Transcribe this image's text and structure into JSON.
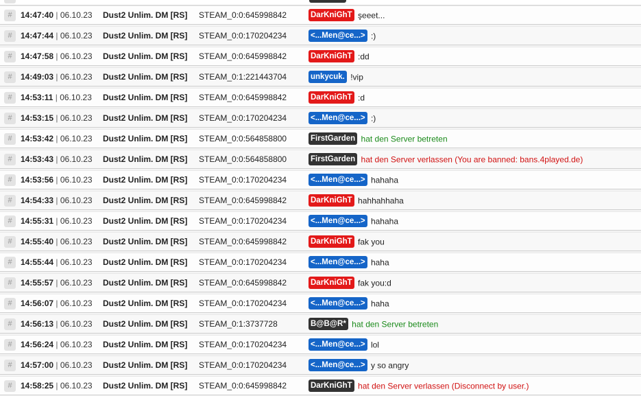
{
  "colors": {
    "red": "#e31919",
    "blue": "#1565c8",
    "dark": "#333333",
    "join": "#1a8a1a",
    "leave": "#d11111"
  },
  "icons": {
    "row_marker": "hash-icon"
  },
  "rows": [
    {
      "hash": "#",
      "time": "14:47:40",
      "sep": "|",
      "date": "06.10.23",
      "server": "Dust2 Unlim. DM [RS]",
      "steam": "STEAM_0:0:645998842",
      "player": "DarKniGhT",
      "color": "red",
      "msg": "şeeet...",
      "kind": "chat"
    },
    {
      "hash": "#",
      "time": "14:47:44",
      "sep": "|",
      "date": "06.10.23",
      "server": "Dust2 Unlim. DM [RS]",
      "steam": "STEAM_0:0:170204234",
      "player": "<...Men@ce...>",
      "color": "blue",
      "msg": ":)",
      "kind": "chat"
    },
    {
      "hash": "#",
      "time": "14:47:58",
      "sep": "|",
      "date": "06.10.23",
      "server": "Dust2 Unlim. DM [RS]",
      "steam": "STEAM_0:0:645998842",
      "player": "DarKniGhT",
      "color": "red",
      "msg": ":dd",
      "kind": "chat"
    },
    {
      "hash": "#",
      "time": "14:49:03",
      "sep": "|",
      "date": "06.10.23",
      "server": "Dust2 Unlim. DM [RS]",
      "steam": "STEAM_0:1:221443704",
      "player": "unkycuk.",
      "color": "blue",
      "msg": "!vip",
      "kind": "chat"
    },
    {
      "hash": "#",
      "time": "14:53:11",
      "sep": "|",
      "date": "06.10.23",
      "server": "Dust2 Unlim. DM [RS]",
      "steam": "STEAM_0:0:645998842",
      "player": "DarKniGhT",
      "color": "red",
      "msg": ":d",
      "kind": "chat"
    },
    {
      "hash": "#",
      "time": "14:53:15",
      "sep": "|",
      "date": "06.10.23",
      "server": "Dust2 Unlim. DM [RS]",
      "steam": "STEAM_0:0:170204234",
      "player": "<...Men@ce...>",
      "color": "blue",
      "msg": ":)",
      "kind": "chat"
    },
    {
      "hash": "#",
      "time": "14:53:42",
      "sep": "|",
      "date": "06.10.23",
      "server": "Dust2 Unlim. DM [RS]",
      "steam": "STEAM_0:0:564858800",
      "player": "FirstGarden",
      "color": "dark",
      "msg": "hat den Server betreten",
      "kind": "join"
    },
    {
      "hash": "#",
      "time": "14:53:43",
      "sep": "|",
      "date": "06.10.23",
      "server": "Dust2 Unlim. DM [RS]",
      "steam": "STEAM_0:0:564858800",
      "player": "FirstGarden",
      "color": "dark",
      "msg": "hat den Server verlassen (You are banned: bans.4played.de)",
      "kind": "leave"
    },
    {
      "hash": "#",
      "time": "14:53:56",
      "sep": "|",
      "date": "06.10.23",
      "server": "Dust2 Unlim. DM [RS]",
      "steam": "STEAM_0:0:170204234",
      "player": "<...Men@ce...>",
      "color": "blue",
      "msg": "hahaha",
      "kind": "chat"
    },
    {
      "hash": "#",
      "time": "14:54:33",
      "sep": "|",
      "date": "06.10.23",
      "server": "Dust2 Unlim. DM [RS]",
      "steam": "STEAM_0:0:645998842",
      "player": "DarKniGhT",
      "color": "red",
      "msg": "hahhahhaha",
      "kind": "chat"
    },
    {
      "hash": "#",
      "time": "14:55:31",
      "sep": "|",
      "date": "06.10.23",
      "server": "Dust2 Unlim. DM [RS]",
      "steam": "STEAM_0:0:170204234",
      "player": "<...Men@ce...>",
      "color": "blue",
      "msg": "hahaha",
      "kind": "chat"
    },
    {
      "hash": "#",
      "time": "14:55:40",
      "sep": "|",
      "date": "06.10.23",
      "server": "Dust2 Unlim. DM [RS]",
      "steam": "STEAM_0:0:645998842",
      "player": "DarKniGhT",
      "color": "red",
      "msg": "fak you",
      "kind": "chat"
    },
    {
      "hash": "#",
      "time": "14:55:44",
      "sep": "|",
      "date": "06.10.23",
      "server": "Dust2 Unlim. DM [RS]",
      "steam": "STEAM_0:0:170204234",
      "player": "<...Men@ce...>",
      "color": "blue",
      "msg": "haha",
      "kind": "chat"
    },
    {
      "hash": "#",
      "time": "14:55:57",
      "sep": "|",
      "date": "06.10.23",
      "server": "Dust2 Unlim. DM [RS]",
      "steam": "STEAM_0:0:645998842",
      "player": "DarKniGhT",
      "color": "red",
      "msg": "fak you:d",
      "kind": "chat"
    },
    {
      "hash": "#",
      "time": "14:56:07",
      "sep": "|",
      "date": "06.10.23",
      "server": "Dust2 Unlim. DM [RS]",
      "steam": "STEAM_0:0:170204234",
      "player": "<...Men@ce...>",
      "color": "blue",
      "msg": "haha",
      "kind": "chat"
    },
    {
      "hash": "#",
      "time": "14:56:13",
      "sep": "|",
      "date": "06.10.23",
      "server": "Dust2 Unlim. DM [RS]",
      "steam": "STEAM_0:1:3737728",
      "player": "B@B@R*",
      "color": "dark",
      "msg": "hat den Server betreten",
      "kind": "join"
    },
    {
      "hash": "#",
      "time": "14:56:24",
      "sep": "|",
      "date": "06.10.23",
      "server": "Dust2 Unlim. DM [RS]",
      "steam": "STEAM_0:0:170204234",
      "player": "<...Men@ce...>",
      "color": "blue",
      "msg": "lol",
      "kind": "chat"
    },
    {
      "hash": "#",
      "time": "14:57:00",
      "sep": "|",
      "date": "06.10.23",
      "server": "Dust2 Unlim. DM [RS]",
      "steam": "STEAM_0:0:170204234",
      "player": "<...Men@ce...>",
      "color": "blue",
      "msg": "y so angry",
      "kind": "chat"
    },
    {
      "hash": "#",
      "time": "14:58:25",
      "sep": "|",
      "date": "06.10.23",
      "server": "Dust2 Unlim. DM [RS]",
      "steam": "STEAM_0:0:645998842",
      "player": "DarKniGhT",
      "color": "dark",
      "msg": "hat den Server verlassen (Disconnect by user.)",
      "kind": "leave"
    }
  ]
}
